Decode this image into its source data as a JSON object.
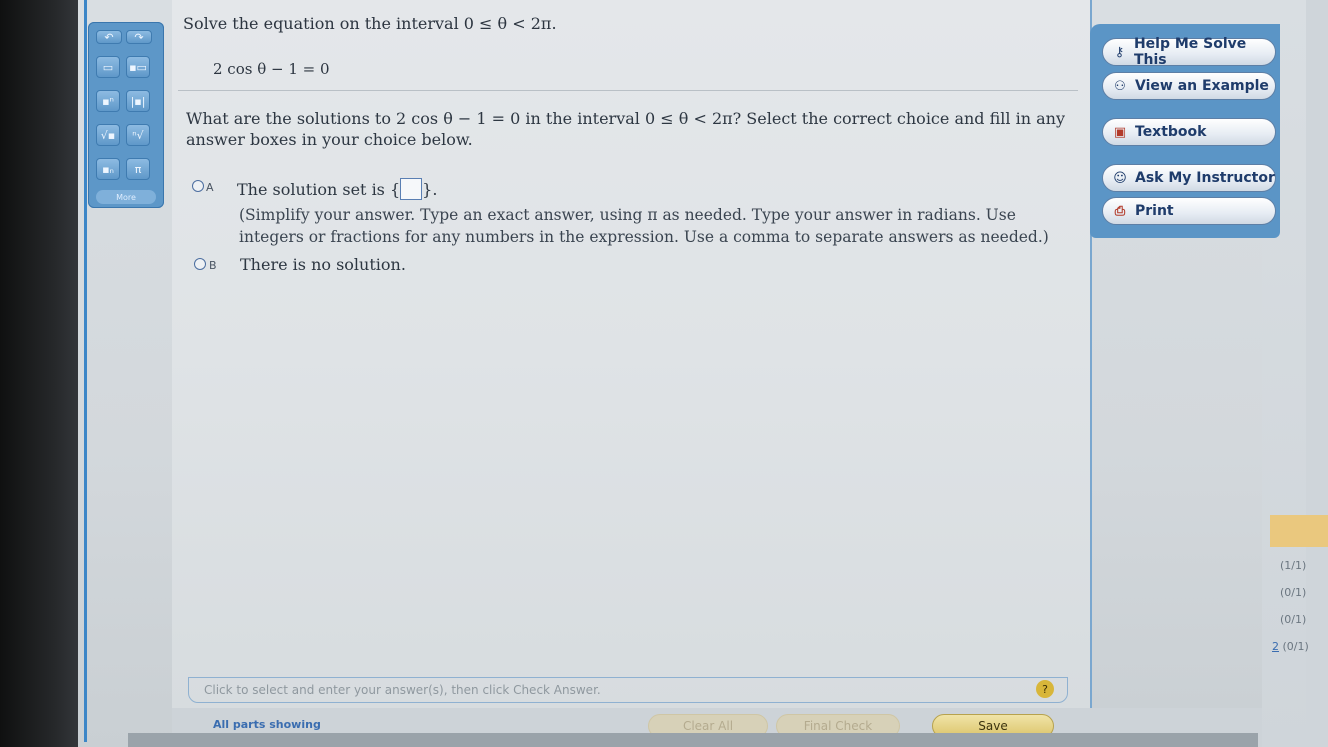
{
  "question": {
    "instruction": "Solve the equation on the interval 0 ≤ θ < 2π.",
    "equation": "2 cos θ − 1 = 0",
    "prompt": "What are the solutions to 2 cos θ − 1 = 0 in the interval 0 ≤ θ < 2π? Select the correct choice and fill in any answer boxes in your choice below.",
    "choices": [
      {
        "letter": "A",
        "text_before": "The solution set is {",
        "text_after": "}.",
        "hint": "(Simplify your answer. Type an exact answer, using π as needed. Type your answer in radians. Use integers or fractions for any numbers in the expression. Use a comma to separate answers as needed.)"
      },
      {
        "letter": "B",
        "text": "There is no solution."
      }
    ],
    "footer_instruction": "Click to select and enter your answer(s), then click Check Answer.",
    "help_symbol": "?"
  },
  "palette": {
    "tools": [
      "⅟",
      "✕",
      "▯",
      "▯",
      "▮",
      "▮",
      "√",
      "∛",
      "▯",
      "π"
    ],
    "more_label": "More"
  },
  "actions": [
    {
      "label": "Help Me Solve This",
      "icon": "key-icon"
    },
    {
      "label": "View an Example",
      "icon": "binoculars-icon"
    },
    {
      "label": "Textbook",
      "icon": "book-icon"
    },
    {
      "label": "Ask My Instructor",
      "icon": "person-icon"
    },
    {
      "label": "Print",
      "icon": "printer-icon"
    }
  ],
  "bottom": {
    "status": "All parts showing",
    "clear_all": "Clear All",
    "final_check": "Final Check",
    "save": "Save"
  },
  "scores": [
    {
      "prefix": "",
      "value": "(1/1)"
    },
    {
      "prefix": "",
      "value": "(0/1)"
    },
    {
      "prefix": "",
      "value": "(0/1)"
    },
    {
      "prefix": "2",
      "value": "(0/1)"
    }
  ],
  "colors": {
    "accent_blue": "#3c86c7",
    "save_gold": "#dcc56b",
    "orange_band": "#eac87e"
  }
}
